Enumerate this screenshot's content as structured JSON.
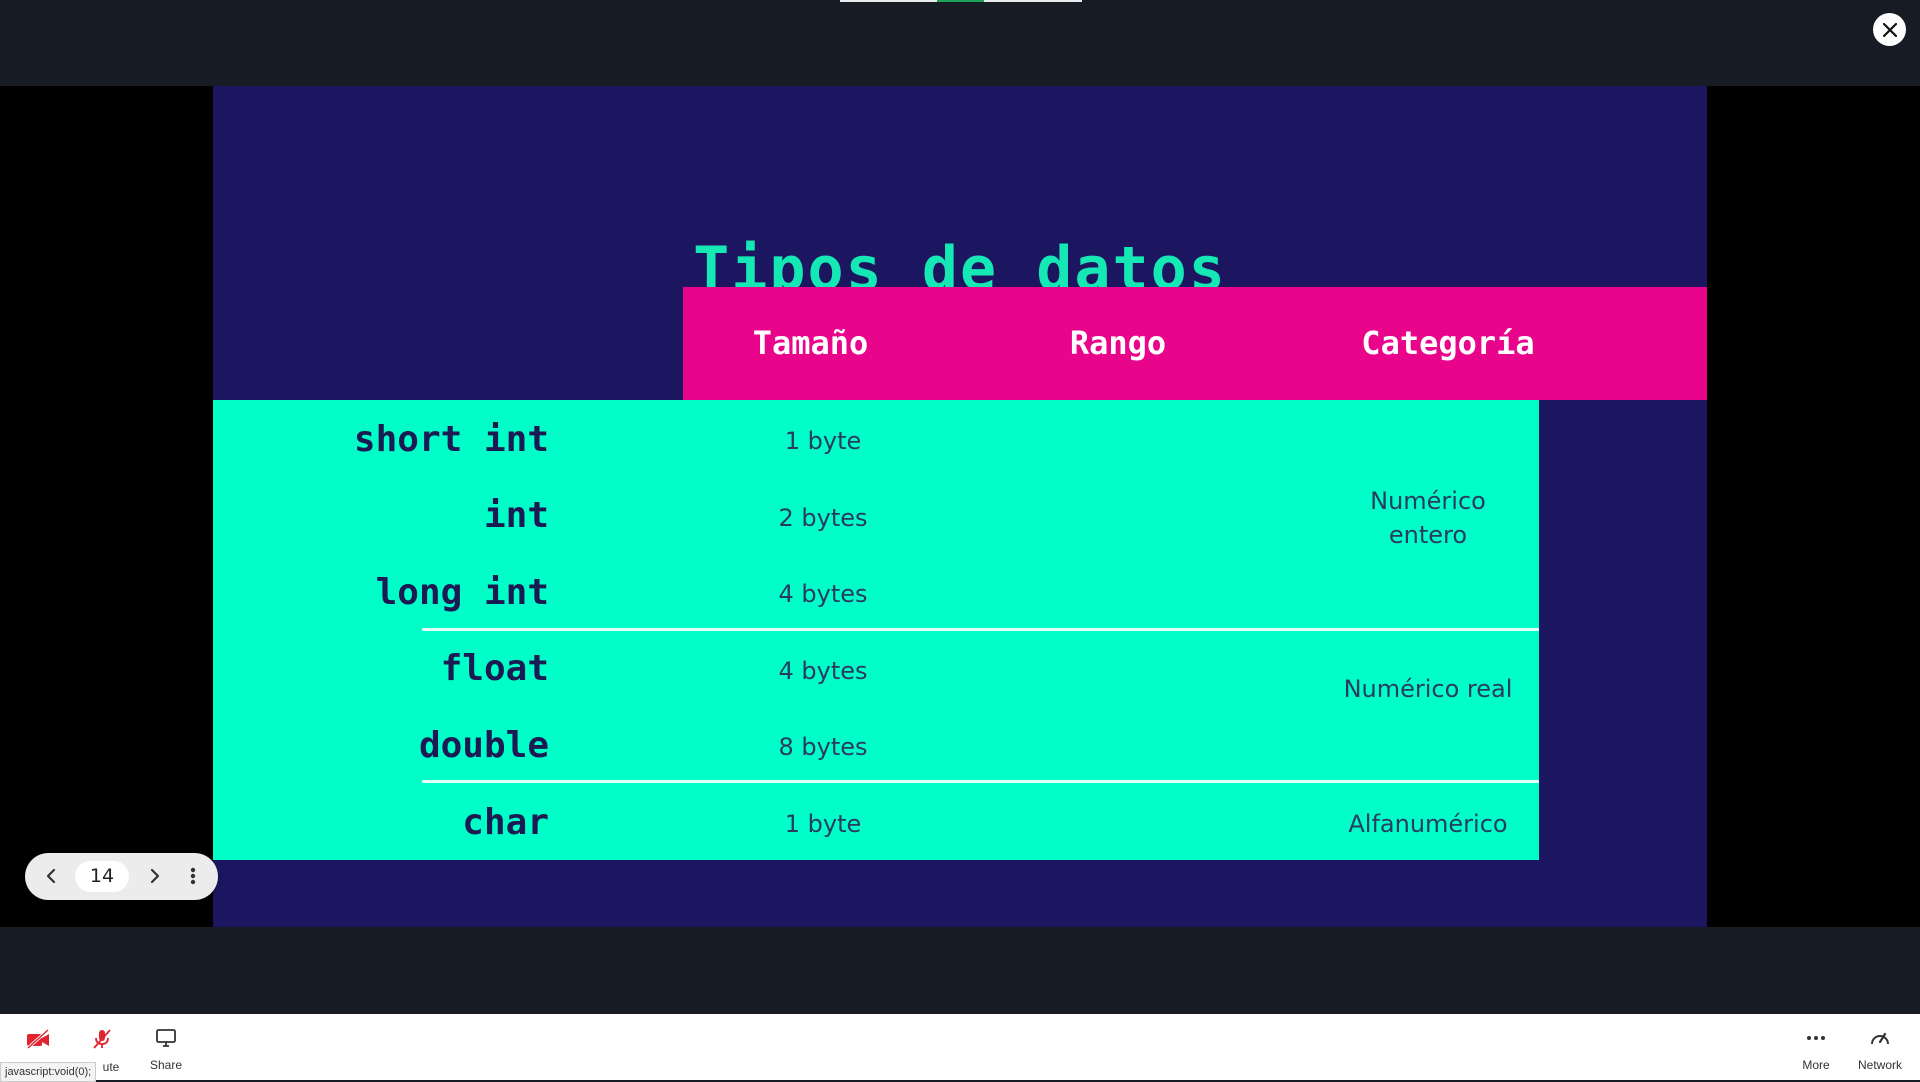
{
  "slide": {
    "title": "Tipos de datos",
    "columns": [
      "Tamaño",
      "Rango",
      "Categoría"
    ],
    "rows": [
      {
        "type": "short int",
        "size": "1 byte"
      },
      {
        "type": "int",
        "size": "2 bytes"
      },
      {
        "type": "long int",
        "size": "4 bytes"
      },
      {
        "type": "float",
        "size": "4 bytes"
      },
      {
        "type": "double",
        "size": "8 bytes"
      },
      {
        "type": "char",
        "size": "1 byte"
      }
    ],
    "categories": {
      "integer_line1": "Numérico",
      "integer_line2": "entero",
      "real": "Numérico real",
      "alnum": "Alfanumérico"
    },
    "colors": {
      "background": "#1c1660",
      "title": "#16e8b5",
      "header": "#e8058c",
      "body": "#00ffc8"
    }
  },
  "pager": {
    "current_page": "14",
    "prev_icon": "chevron-left-icon",
    "next_icon": "chevron-right-icon",
    "menu_icon": "more-vertical-icon"
  },
  "toolbar": {
    "mute_label": "ute",
    "share_label": "Share",
    "more_label": "More",
    "network_label": "Network"
  },
  "status_bar": {
    "url": "javascript:void(0);"
  }
}
